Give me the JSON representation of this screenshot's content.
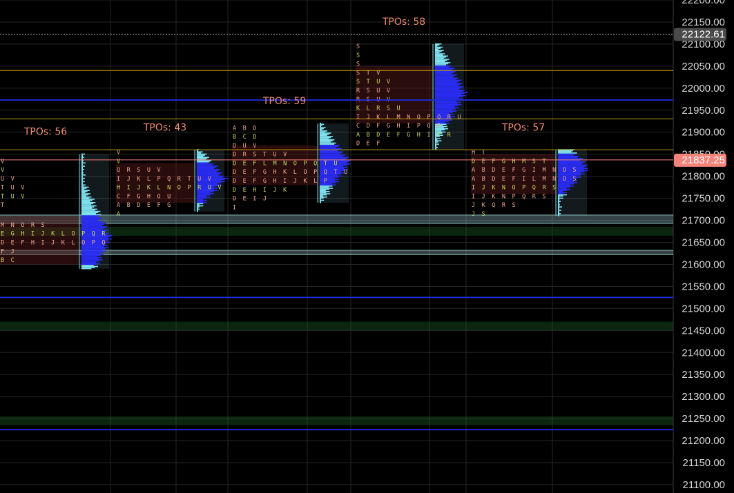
{
  "chart_data": {
    "type": "tpo-market-profile",
    "y_axis": {
      "range": [
        21100,
        22200
      ],
      "ticks": [
        "22200.00",
        "22150.00",
        "22100.00",
        "22050.00",
        "22000.00",
        "21950.00",
        "21900.00",
        "21850.00",
        "21800.00",
        "21750.00",
        "21700.00",
        "21650.00",
        "21600.00",
        "21550.00",
        "21500.00",
        "21450.00",
        "21400.00",
        "21350.00",
        "21300.00",
        "21250.00",
        "21200.00",
        "21150.00",
        "21100.00"
      ]
    },
    "price_badges": [
      {
        "label": "22122.61",
        "price": 22122.61,
        "color": "#4a4a4a"
      },
      {
        "label": "21837.25",
        "price": 21837.25,
        "color": "#f4837b"
      }
    ],
    "sessions": [
      {
        "title": "TPOs: 56",
        "profile_low": 21590,
        "profile_high": 21850,
        "va_low": 21600,
        "va_high": 21710,
        "poc": 21660,
        "letters": [
          {
            "price": 21835,
            "text": "V"
          },
          {
            "price": 21815,
            "text": "V"
          },
          {
            "price": 21795,
            "text": "U V"
          },
          {
            "price": 21775,
            "text": "T U V"
          },
          {
            "price": 21755,
            "text": "T U V"
          },
          {
            "price": 21735,
            "text": "T"
          },
          {
            "price": 21690,
            "text": "M N O R S"
          },
          {
            "price": 21670,
            "text": "E G H I J K L O P Q R"
          },
          {
            "price": 21650,
            "text": "D E F H I J K L O P Q"
          },
          {
            "price": 21630,
            "text": "F J"
          },
          {
            "price": 21610,
            "text": "B C"
          }
        ]
      },
      {
        "title": "TPOs: 43",
        "profile_low": 21720,
        "profile_high": 21860,
        "va_low": 21740,
        "va_high": 21830,
        "poc": 21795,
        "letters": [
          {
            "price": 21855,
            "text": "V"
          },
          {
            "price": 21835,
            "text": "V"
          },
          {
            "price": 21815,
            "text": "Q R S U V"
          },
          {
            "price": 21795,
            "text": "I J K L P Q R T U V"
          },
          {
            "price": 21775,
            "text": "H I J K L N O P R U V"
          },
          {
            "price": 21755,
            "text": "C F G H O U"
          },
          {
            "price": 21735,
            "text": "A B D E F G"
          },
          {
            "price": 21715,
            "text": "A"
          }
        ]
      },
      {
        "title": "TPOs: 59",
        "profile_low": 21740,
        "profile_high": 21920,
        "va_low": 21780,
        "va_high": 21870,
        "poc": 21830,
        "letters": [
          {
            "price": 21910,
            "text": "A B D"
          },
          {
            "price": 21890,
            "text": "B C D"
          },
          {
            "price": 21870,
            "text": "D U V"
          },
          {
            "price": 21850,
            "text": "D R S T U V"
          },
          {
            "price": 21830,
            "text": "D E F L M N O P Q T U"
          },
          {
            "price": 21810,
            "text": "D E F G H K L O P Q T U"
          },
          {
            "price": 21790,
            "text": "D E F G H I J K L P"
          },
          {
            "price": 21770,
            "text": "D E H I J K"
          },
          {
            "price": 21750,
            "text": "D E I J"
          },
          {
            "price": 21730,
            "text": "I"
          }
        ]
      },
      {
        "title": "TPOs: 58",
        "profile_low": 21860,
        "profile_high": 22100,
        "va_low": 21920,
        "va_high": 22050,
        "poc": 21990,
        "letters": [
          {
            "price": 22095,
            "text": "S"
          },
          {
            "price": 22075,
            "text": "S"
          },
          {
            "price": 22055,
            "text": "S"
          },
          {
            "price": 22035,
            "text": "S T V"
          },
          {
            "price": 22015,
            "text": "S T U V"
          },
          {
            "price": 21995,
            "text": "R S U V"
          },
          {
            "price": 21975,
            "text": "R S U V"
          },
          {
            "price": 21955,
            "text": "K L R S U"
          },
          {
            "price": 21935,
            "text": "I J K L M N O P Q R U"
          },
          {
            "price": 21915,
            "text": "C D F G H I P Q R"
          },
          {
            "price": 21895,
            "text": "A B D E F G H I P R"
          },
          {
            "price": 21875,
            "text": "D E F"
          }
        ]
      },
      {
        "title": "TPOs: 57",
        "profile_low": 21710,
        "profile_high": 21860,
        "va_low": 21760,
        "va_high": 21850,
        "poc": 21820,
        "letters": [
          {
            "price": 21855,
            "text": "H T"
          },
          {
            "price": 21835,
            "text": "D E F G H M S T"
          },
          {
            "price": 21815,
            "text": "A B D E F G I M N O S"
          },
          {
            "price": 21795,
            "text": "A B D E F I L M N O S"
          },
          {
            "price": 21775,
            "text": "I J K N O P Q R S"
          },
          {
            "price": 21755,
            "text": "I J K N P Q R S"
          },
          {
            "price": 21735,
            "text": "J K Q R S"
          },
          {
            "price": 21715,
            "text": "J S"
          }
        ]
      }
    ],
    "reference_lines": [
      {
        "price": 22122.61,
        "color": "#bbbbbb",
        "style": "dotted"
      },
      {
        "price": 21837.25,
        "color": "#f4837b",
        "style": "solid"
      },
      {
        "price": 21525,
        "color": "#1f2bd6",
        "style": "solid"
      },
      {
        "price": 21225,
        "color": "#1f2bd6",
        "style": "solid"
      },
      {
        "price": 21973,
        "color": "#1f2bd6",
        "style": "solid"
      },
      {
        "price": 22040,
        "color": "#c9a21a",
        "style": "solid"
      },
      {
        "price": 21930,
        "color": "#c9a21a",
        "style": "solid"
      },
      {
        "price": 21860,
        "color": "#c9a21a",
        "style": "solid"
      }
    ],
    "zones": [
      {
        "low": 21693,
        "high": 21712,
        "color": "#b9f4f4"
      },
      {
        "low": 21622,
        "high": 21632,
        "color": "#b9f4f4"
      },
      {
        "low": 21665,
        "high": 21685,
        "color": "#1f6b2a"
      },
      {
        "low": 21450,
        "high": 21470,
        "color": "#1f6b2a"
      },
      {
        "low": 21235,
        "high": 21255,
        "color": "#1f6b2a"
      }
    ],
    "grid": true,
    "colors": {
      "background": "#000000",
      "grid": "#262626",
      "profile_main": "#2a2cf5",
      "profile_fringe": "#7fe3f0",
      "letters_warm": "#f0a890",
      "letters_accent": "#c9d95a",
      "value_area": "#5a1a1a"
    }
  }
}
